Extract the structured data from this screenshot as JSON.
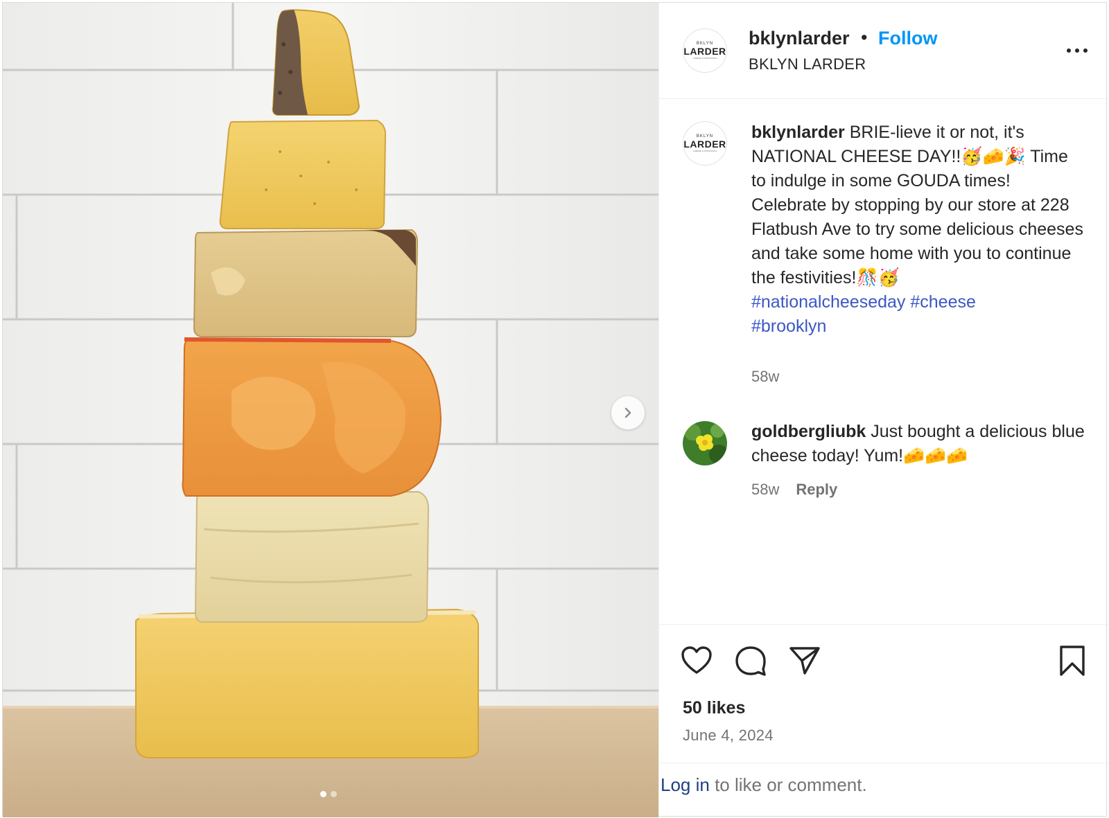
{
  "post": {
    "author": {
      "username": "bklynlarder",
      "display_name": "BKLYN LARDER",
      "follow_label": "Follow",
      "separator": "•",
      "avatar_logo": {
        "line1": "BKLYN",
        "line2": "LARDER",
        "line3": "CHEESE & PROVISIONS"
      },
      "more_icon": "more-horizontal-icon"
    },
    "media": {
      "description_icon": "cheese-stack-photo",
      "next_icon": "chevron-right-icon",
      "carousel_pages": 2,
      "carousel_active": 1
    },
    "caption": {
      "username": "bklynlarder",
      "text_line1": " BRIE-lieve it or not, it's NATIONAL CHEESE DAY!!🥳🧀🎉 Time to indulge in some GOUDA times! Celebrate by stopping by our store at 228 Flatbush Ave to try some delicious cheeses and take some home with you to continue the festivities!🎊🥳",
      "hashtags": [
        "#nationalcheeseday",
        "#cheese",
        "#brooklyn"
      ],
      "time": "58w"
    },
    "comments": [
      {
        "username": "goldbergliubk",
        "text": " Just bought a delicious blue cheese today! Yum!🧀🧀🧀",
        "time": "58w",
        "reply_label": "Reply"
      }
    ],
    "actions": {
      "like_icon": "heart-icon",
      "comment_icon": "comment-icon",
      "share_icon": "share-icon",
      "save_icon": "bookmark-icon"
    },
    "likes": "50 likes",
    "date": "June 4, 2024",
    "login_prompt": {
      "link": "Log in",
      "rest": " to like or comment."
    }
  }
}
